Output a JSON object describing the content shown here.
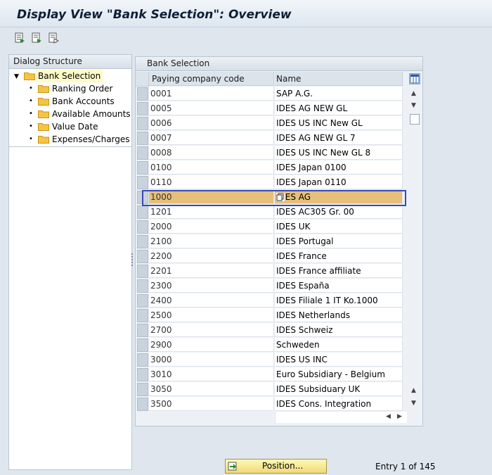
{
  "window": {
    "title": "Display View \"Bank Selection\": Overview"
  },
  "toolbar": {
    "buttons": [
      "select-all-icon",
      "select-block-icon",
      "deselect-all-icon"
    ]
  },
  "dialog_structure": {
    "header": "Dialog Structure",
    "root": "Bank Selection",
    "children": [
      "Ranking Order",
      "Bank Accounts",
      "Available Amounts",
      "Value Date",
      "Expenses/Charges"
    ]
  },
  "table": {
    "title": "Bank Selection",
    "columns": [
      "Paying company code",
      "Name"
    ],
    "rows": [
      {
        "code": "0001",
        "name": "SAP A.G."
      },
      {
        "code": "0005",
        "name": "IDES AG NEW GL"
      },
      {
        "code": "0006",
        "name": "IDES US INC New GL"
      },
      {
        "code": "0007",
        "name": "IDES AG NEW GL 7"
      },
      {
        "code": "0008",
        "name": "IDES US INC New GL 8"
      },
      {
        "code": "0100",
        "name": "IDES Japan 0100"
      },
      {
        "code": "0110",
        "name": "IDES Japan 0110"
      },
      {
        "code": "1000",
        "name": "IDES AG"
      },
      {
        "code": "1201",
        "name": "IDES AC305 Gr. 00"
      },
      {
        "code": "2000",
        "name": "IDES UK"
      },
      {
        "code": "2100",
        "name": "IDES Portugal"
      },
      {
        "code": "2200",
        "name": "IDES France"
      },
      {
        "code": "2201",
        "name": "IDES France affiliate"
      },
      {
        "code": "2300",
        "name": "IDES España"
      },
      {
        "code": "2400",
        "name": "IDES Filiale 1 IT Ko.1000"
      },
      {
        "code": "2500",
        "name": "IDES Netherlands"
      },
      {
        "code": "2700",
        "name": "IDES Schweiz"
      },
      {
        "code": "2900",
        "name": "Schweden"
      },
      {
        "code": "3000",
        "name": "IDES US INC"
      },
      {
        "code": "3010",
        "name": "Euro Subsidiary - Belgium"
      },
      {
        "code": "3050",
        "name": "IDES Subsiduary UK"
      },
      {
        "code": "3500",
        "name": "IDES Cons. Integration"
      }
    ],
    "selected_code": "1000"
  },
  "footer": {
    "position_label": "Position...",
    "entry_text": "Entry 1 of 145"
  },
  "colors": {
    "selected_row": "#e6c07a",
    "focus_border": "#3a48b8",
    "folder": "#f5c542"
  }
}
